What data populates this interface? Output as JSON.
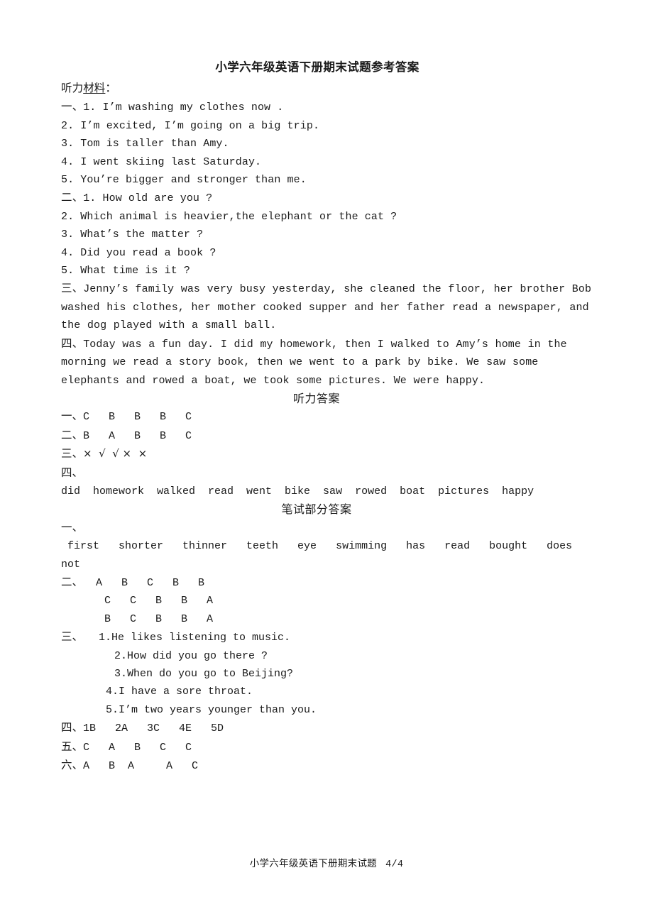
{
  "document": {
    "title": "小学六年级英语下册期末试题参考答案",
    "footer_text": "小学六年级英语下册期末试题",
    "footer_page": "4/4"
  },
  "listening_material": {
    "heading_prefix": "听力",
    "heading_underlined": "材料",
    "heading_suffix": "：",
    "section_one": {
      "label": "一、",
      "lines": [
        "1. I’m washing my clothes now .",
        "2. I’m excited, I’m going on a big trip.",
        "3. Tom is taller than Amy.",
        "4. I went skiing last Saturday.",
        "5. You’re bigger and stronger than me."
      ]
    },
    "section_two": {
      "label": "二、",
      "lines": [
        "1. How old are you ?",
        "2. Which animal is heavier,the elephant or the cat ?",
        "3. What’s the matter ?",
        "4. Did you read a book ?",
        "5. What time is it ?"
      ]
    },
    "section_three": {
      "label": "三、",
      "text": "Jenny’s family was very busy yesterday, she cleaned the floor, her brother Bob washed his clothes, her mother cooked supper and her father read a newspaper, and the dog played with a small ball."
    },
    "section_four": {
      "label": "四、",
      "text": "Today was a fun day. I did my homework, then I walked to Amy’s home in the morning we read a story book, then we went to a park by bike. We saw some elephants and rowed a boat, we took some pictures. We were happy."
    }
  },
  "listening_answers": {
    "heading": "听力答案",
    "rows": [
      {
        "label": "一、",
        "answers": "C   B   B   B   C"
      },
      {
        "label": "二、",
        "answers": "B   A   B   B   C"
      },
      {
        "label": "三、",
        "answers": "×  √  √ ×  ×"
      }
    ],
    "section_four_label": "四、",
    "section_four_words": "did  homework  walked  read  went  bike  saw  rowed  boat  pictures  happy"
  },
  "written_answers": {
    "heading": "笔试部分答案",
    "section_one": {
      "label": "一、",
      "line1": " first   shorter   thinner   teeth   eye   swimming   has   read   bought   does",
      "line2": "not"
    },
    "section_two": {
      "label": "二、",
      "rows": [
        "  A   B   C   B   B",
        "   C   C   B   B   A",
        "   B   C   B   B   A"
      ]
    },
    "section_three": {
      "label": "三、",
      "sentences": [
        "1.He likes listening to music.",
        "2.How did you go there ?",
        "3.When do you go to Beijing?",
        "4.I have a sore throat.",
        "5.I’m two years younger than you."
      ]
    },
    "section_four": {
      "label": "四、",
      "answers": "1B   2A   3C   4E   5D"
    },
    "section_five": {
      "label": "五、",
      "answers": "C   A   B   C   C"
    },
    "section_six": {
      "label": "六、",
      "answers": "A   B  A     A   C"
    }
  }
}
